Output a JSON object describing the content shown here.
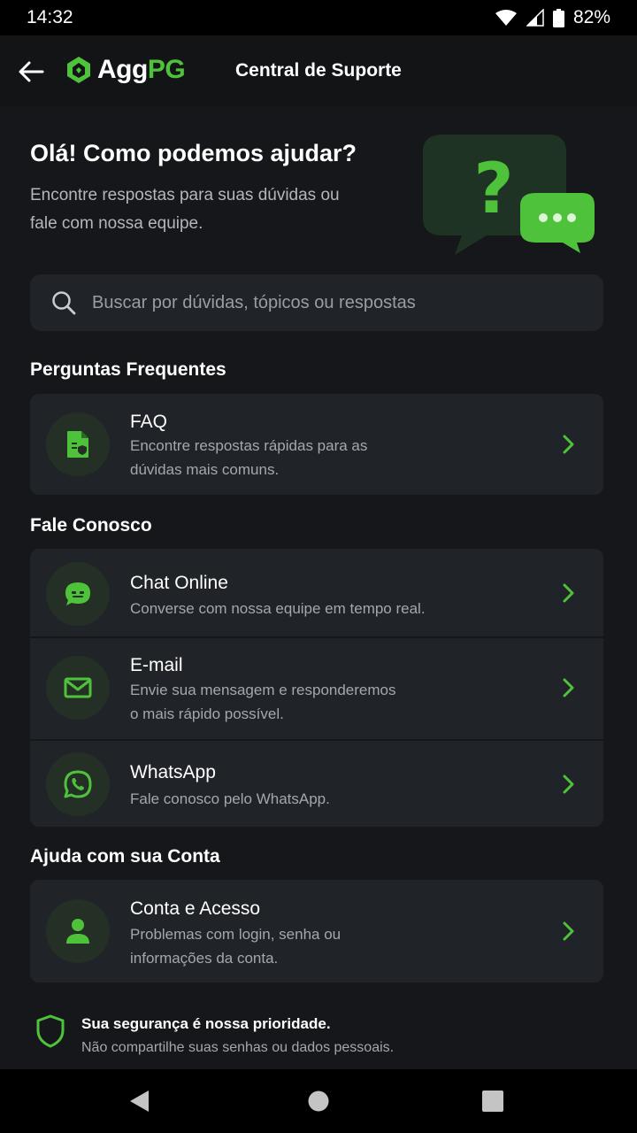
{
  "status_bar": {
    "time": "14:32",
    "battery": "82%"
  },
  "header": {
    "logo_agg": "Agg",
    "logo_pg": "PG",
    "title": "Central de Suporte"
  },
  "hero": {
    "title": "Olá! Como podemos ajudar?",
    "subtitle_line1": "Encontre respostas para suas dúvidas ou",
    "subtitle_line2": "fale com nossa equipe."
  },
  "search": {
    "placeholder": "Buscar por dúvidas, tópicos ou respostas"
  },
  "sections": {
    "faq_title": "Perguntas Frequentes",
    "contact_title": "Fale Conosco",
    "account_title": "Ajuda com sua Conta"
  },
  "faq": {
    "title": "FAQ",
    "desc_line1": "Encontre respostas rápidas para as",
    "desc_line2": "dúvidas mais comuns.",
    "icon": "document-icon"
  },
  "contact": [
    {
      "title": "Chat Online",
      "desc_line1": "Converse com nossa equipe em tempo real.",
      "desc_line2": "",
      "icon": "chat-icon"
    },
    {
      "title": "E-mail",
      "desc_line1": "Envie sua mensagem e responderemos",
      "desc_line2": "o mais rápido possível.",
      "icon": "mail-icon"
    },
    {
      "title": "WhatsApp",
      "desc_line1": "Fale conosco pelo WhatsApp.",
      "desc_line2": "",
      "icon": "whatsapp-icon"
    }
  ],
  "account": {
    "title": "Conta e Acesso",
    "desc_line1": "Problemas com login, senha ou",
    "desc_line2": "informações da conta.",
    "icon": "user-icon"
  },
  "security": {
    "title": "Sua segurança é nossa prioridade.",
    "subtitle": "Não compartilhe suas senhas ou dados pessoais."
  },
  "colors": {
    "accent": "#4fc23c",
    "background": "#15171a",
    "card": "#202327"
  }
}
